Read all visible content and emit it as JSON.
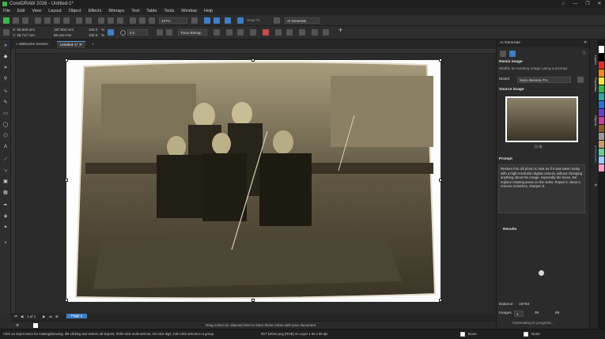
{
  "window": {
    "title": "CorelDRAW 2026 - Untitled-1*"
  },
  "menu": [
    "File",
    "Edit",
    "View",
    "Layout",
    "Object",
    "Effects",
    "Bitmaps",
    "Text",
    "Table",
    "Tools",
    "Window",
    "Help"
  ],
  "standard_toolbar": {
    "zoom": "227%",
    "snap_to": "Snap To",
    "ai_generate": "AI Generate"
  },
  "property_bar": {
    "x": "X: 50.829 mm",
    "y": "Y: 46.717 mm",
    "width": "157.602 mm",
    "height": "86.442 mm",
    "scale_x": "100.0",
    "scale_y": "100.0",
    "percent": "%",
    "angle": "0.0",
    "trace_bitmap": "Trace Bitmap"
  },
  "tabs": {
    "welcome": "Welcome Screen",
    "document": "Untitled-1*",
    "add": "+"
  },
  "pages": {
    "counter": "1 of 1",
    "current": "Page 1"
  },
  "status": {
    "hint": "Drag colors (or objects) here to store these colors with your document",
    "click_hint": "Click an object twice for rotating/skewing; dbl-clicking tool selects all objects; Shift+click multi-selects; Alt+click digs; Ctrl+click selects in a group",
    "object_info": "RxT before.png (RGB) on Layer 1 96 x 96 dpi",
    "fill_none": "None",
    "outline_none": "None"
  },
  "docker": {
    "title": "AI Generate",
    "section_remix": "Remix image",
    "remix_desc": "Modify an existing image using a prompt.",
    "model_label": "Model",
    "model_value": "Nano Banana Pro",
    "source_image": "Source image",
    "prompt_label": "Prompt",
    "prompt_text": "Restore this old photo to look as if it was taken today with a high-resolution digital camera, without changing anything about the image, especially the faces, but replace missing areas on the sides. Repair it, clean it, remove scratches, sharpen it.",
    "results_label": "Results",
    "balance_label": "Balance:",
    "balance_value": "18764",
    "images_label": "Images",
    "images_value": "1",
    "ratio_a": "96",
    "ratio_b": "96",
    "generating": "Generating in progress..."
  },
  "side_tabs": [
    "Layers",
    "Properties",
    "Objects",
    "AI Generate"
  ],
  "colors": {
    "accent": "#3e7fc9",
    "panel_bg": "#2b2b2b",
    "canvas_bg": "#2a2a2a",
    "page_bg": "#fdfdfd",
    "sepia_dark": "#2e2a1e",
    "sepia_light": "#8a8068"
  },
  "palette": [
    "#ffffff",
    "#000000",
    "#e32b2b",
    "#f08a24",
    "#f5e43a",
    "#3bb54a",
    "#2fa6a6",
    "#2b6fd6",
    "#6b3fc4",
    "#c43fa0",
    "#8b5a2b",
    "#9a9a9a",
    "#cc9966",
    "#66cc99",
    "#99ccff",
    "#ff99cc"
  ]
}
